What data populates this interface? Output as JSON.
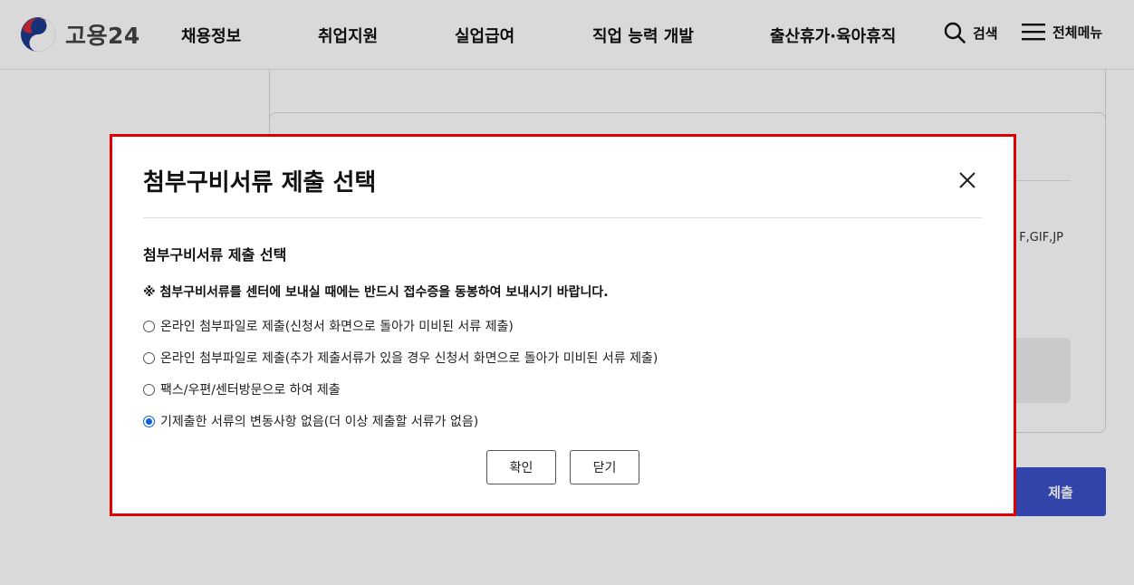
{
  "header": {
    "logo_text": "고용24",
    "nav": [
      "채용정보",
      "취업지원",
      "실업급여",
      "직업 능력 개발",
      "출산휴가·육아휴직"
    ],
    "search_label": "검색",
    "menu_label": "전체메뉴"
  },
  "background": {
    "filetypes_text": "F,GIF,JP",
    "submit_label": "제출",
    "submit_color": "#3b4fc8"
  },
  "modal": {
    "title": "첨부구비서류 제출 선택",
    "section_title": "첨부구비서류 제출 선택",
    "notice": "※ 첨부구비서류를 센터에 보내실 때에는 반드시 접수증을 동봉하여 보내시기 바랍니다.",
    "options": [
      {
        "label": "온라인 첨부파일로 제출(신청서 화면으로 돌아가 미비된 서류 제출)",
        "checked": false
      },
      {
        "label": "온라인 첨부파일로 제출(추가 제출서류가 있을 경우 신청서 화면으로 돌아가 미비된 서류 제출)",
        "checked": false
      },
      {
        "label": "팩스/우편/센터방문으로 하여 제출",
        "checked": false
      },
      {
        "label": "기제출한 서류의 변동사항 없음(더 이상 제출할 서류가 없음)",
        "checked": true
      }
    ],
    "confirm_label": "확인",
    "close_label": "닫기",
    "highlight_border_color": "#e10000",
    "radio_checked_color": "#0a64d8"
  }
}
